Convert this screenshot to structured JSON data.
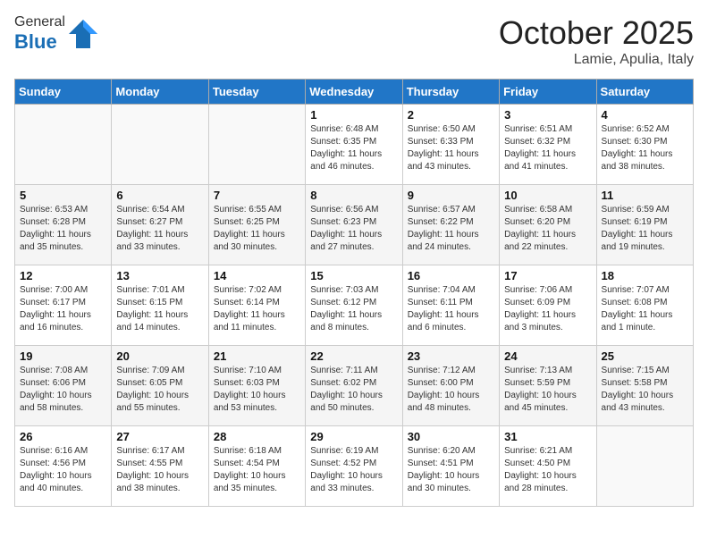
{
  "header": {
    "logo_general": "General",
    "logo_blue": "Blue",
    "month_title": "October 2025",
    "location": "Lamie, Apulia, Italy"
  },
  "weekdays": [
    "Sunday",
    "Monday",
    "Tuesday",
    "Wednesday",
    "Thursday",
    "Friday",
    "Saturday"
  ],
  "weeks": [
    [
      {
        "day": "",
        "info": ""
      },
      {
        "day": "",
        "info": ""
      },
      {
        "day": "",
        "info": ""
      },
      {
        "day": "1",
        "info": "Sunrise: 6:48 AM\nSunset: 6:35 PM\nDaylight: 11 hours\nand 46 minutes."
      },
      {
        "day": "2",
        "info": "Sunrise: 6:50 AM\nSunset: 6:33 PM\nDaylight: 11 hours\nand 43 minutes."
      },
      {
        "day": "3",
        "info": "Sunrise: 6:51 AM\nSunset: 6:32 PM\nDaylight: 11 hours\nand 41 minutes."
      },
      {
        "day": "4",
        "info": "Sunrise: 6:52 AM\nSunset: 6:30 PM\nDaylight: 11 hours\nand 38 minutes."
      }
    ],
    [
      {
        "day": "5",
        "info": "Sunrise: 6:53 AM\nSunset: 6:28 PM\nDaylight: 11 hours\nand 35 minutes."
      },
      {
        "day": "6",
        "info": "Sunrise: 6:54 AM\nSunset: 6:27 PM\nDaylight: 11 hours\nand 33 minutes."
      },
      {
        "day": "7",
        "info": "Sunrise: 6:55 AM\nSunset: 6:25 PM\nDaylight: 11 hours\nand 30 minutes."
      },
      {
        "day": "8",
        "info": "Sunrise: 6:56 AM\nSunset: 6:23 PM\nDaylight: 11 hours\nand 27 minutes."
      },
      {
        "day": "9",
        "info": "Sunrise: 6:57 AM\nSunset: 6:22 PM\nDaylight: 11 hours\nand 24 minutes."
      },
      {
        "day": "10",
        "info": "Sunrise: 6:58 AM\nSunset: 6:20 PM\nDaylight: 11 hours\nand 22 minutes."
      },
      {
        "day": "11",
        "info": "Sunrise: 6:59 AM\nSunset: 6:19 PM\nDaylight: 11 hours\nand 19 minutes."
      }
    ],
    [
      {
        "day": "12",
        "info": "Sunrise: 7:00 AM\nSunset: 6:17 PM\nDaylight: 11 hours\nand 16 minutes."
      },
      {
        "day": "13",
        "info": "Sunrise: 7:01 AM\nSunset: 6:15 PM\nDaylight: 11 hours\nand 14 minutes."
      },
      {
        "day": "14",
        "info": "Sunrise: 7:02 AM\nSunset: 6:14 PM\nDaylight: 11 hours\nand 11 minutes."
      },
      {
        "day": "15",
        "info": "Sunrise: 7:03 AM\nSunset: 6:12 PM\nDaylight: 11 hours\nand 8 minutes."
      },
      {
        "day": "16",
        "info": "Sunrise: 7:04 AM\nSunset: 6:11 PM\nDaylight: 11 hours\nand 6 minutes."
      },
      {
        "day": "17",
        "info": "Sunrise: 7:06 AM\nSunset: 6:09 PM\nDaylight: 11 hours\nand 3 minutes."
      },
      {
        "day": "18",
        "info": "Sunrise: 7:07 AM\nSunset: 6:08 PM\nDaylight: 11 hours\nand 1 minute."
      }
    ],
    [
      {
        "day": "19",
        "info": "Sunrise: 7:08 AM\nSunset: 6:06 PM\nDaylight: 10 hours\nand 58 minutes."
      },
      {
        "day": "20",
        "info": "Sunrise: 7:09 AM\nSunset: 6:05 PM\nDaylight: 10 hours\nand 55 minutes."
      },
      {
        "day": "21",
        "info": "Sunrise: 7:10 AM\nSunset: 6:03 PM\nDaylight: 10 hours\nand 53 minutes."
      },
      {
        "day": "22",
        "info": "Sunrise: 7:11 AM\nSunset: 6:02 PM\nDaylight: 10 hours\nand 50 minutes."
      },
      {
        "day": "23",
        "info": "Sunrise: 7:12 AM\nSunset: 6:00 PM\nDaylight: 10 hours\nand 48 minutes."
      },
      {
        "day": "24",
        "info": "Sunrise: 7:13 AM\nSunset: 5:59 PM\nDaylight: 10 hours\nand 45 minutes."
      },
      {
        "day": "25",
        "info": "Sunrise: 7:15 AM\nSunset: 5:58 PM\nDaylight: 10 hours\nand 43 minutes."
      }
    ],
    [
      {
        "day": "26",
        "info": "Sunrise: 6:16 AM\nSunset: 4:56 PM\nDaylight: 10 hours\nand 40 minutes."
      },
      {
        "day": "27",
        "info": "Sunrise: 6:17 AM\nSunset: 4:55 PM\nDaylight: 10 hours\nand 38 minutes."
      },
      {
        "day": "28",
        "info": "Sunrise: 6:18 AM\nSunset: 4:54 PM\nDaylight: 10 hours\nand 35 minutes."
      },
      {
        "day": "29",
        "info": "Sunrise: 6:19 AM\nSunset: 4:52 PM\nDaylight: 10 hours\nand 33 minutes."
      },
      {
        "day": "30",
        "info": "Sunrise: 6:20 AM\nSunset: 4:51 PM\nDaylight: 10 hours\nand 30 minutes."
      },
      {
        "day": "31",
        "info": "Sunrise: 6:21 AM\nSunset: 4:50 PM\nDaylight: 10 hours\nand 28 minutes."
      },
      {
        "day": "",
        "info": ""
      }
    ]
  ]
}
